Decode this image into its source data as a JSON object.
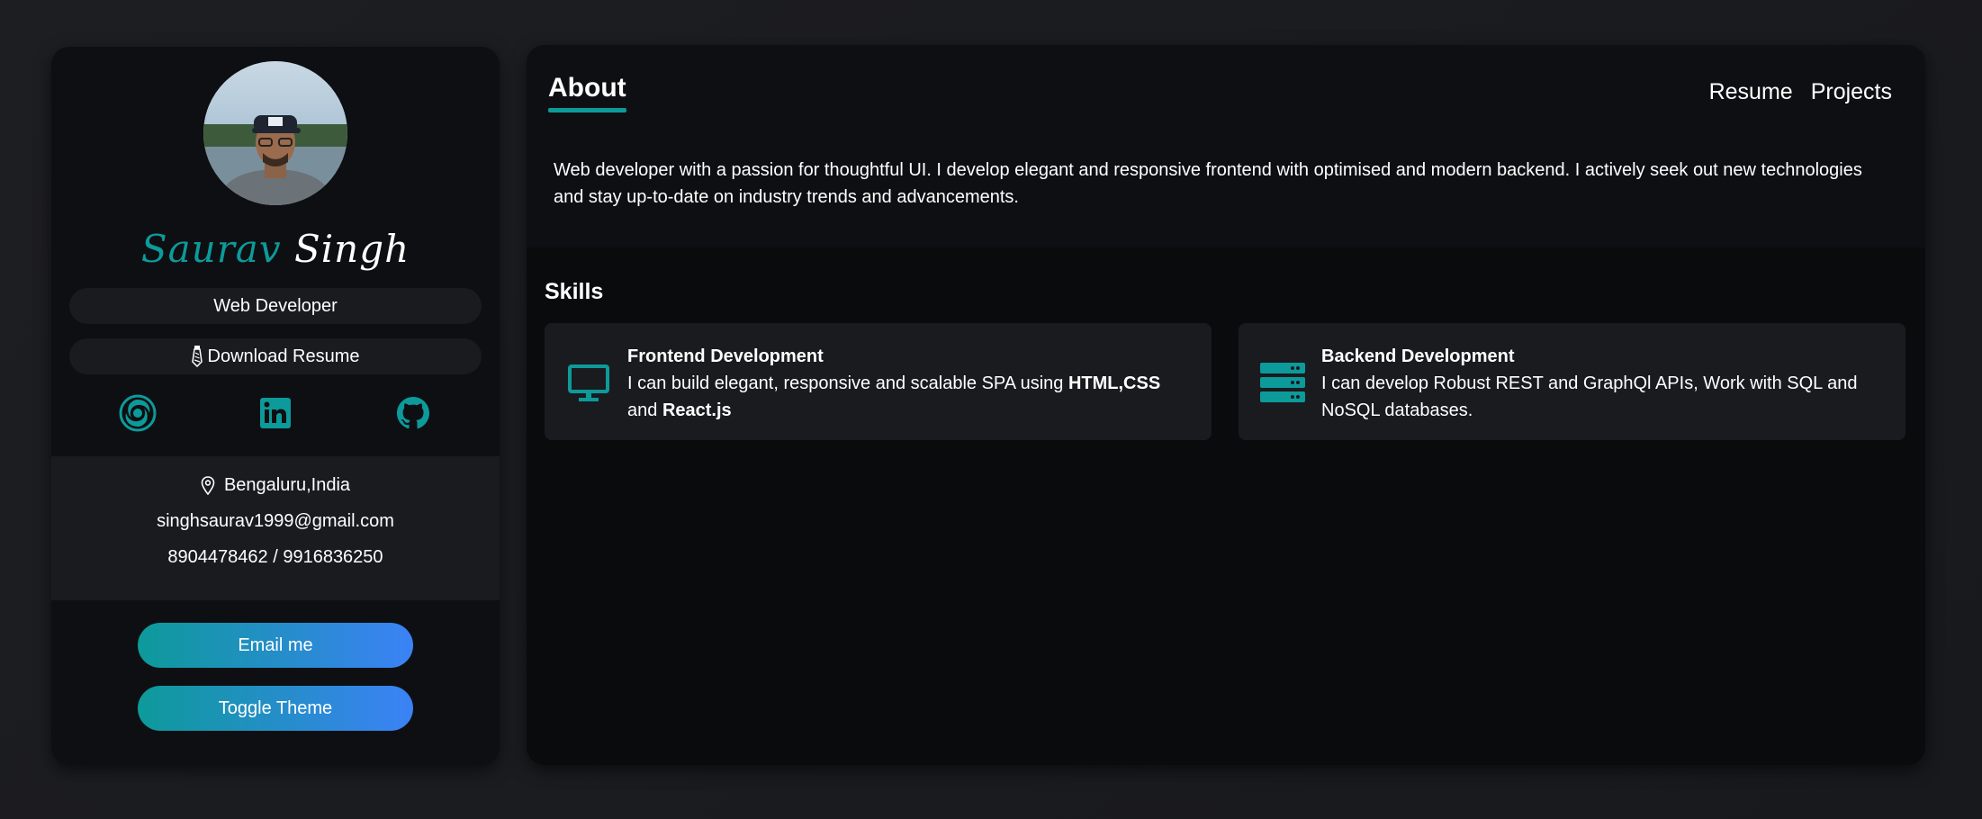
{
  "profile": {
    "first_name": "Saurav",
    "last_name": "Singh",
    "role": "Web Developer",
    "download_label": "Download Resume",
    "location": "Bengaluru,India",
    "email": "singhsaurav1999@gmail.com",
    "phone": "8904478462 / 9916836250"
  },
  "socials": [
    {
      "icon": "swirl-logo-icon"
    },
    {
      "icon": "linkedin-icon"
    },
    {
      "icon": "github-icon"
    }
  ],
  "buttons": {
    "email": "Email me",
    "theme": "Toggle Theme"
  },
  "header": {
    "title": "About",
    "nav": [
      "Resume",
      "Projects"
    ]
  },
  "about": {
    "text": "Web developer with a passion for thoughtful UI. I develop elegant and responsive frontend with optimised and modern backend. I actively seek out new technologies and stay up-to-date on industry trends and advancements."
  },
  "skills": {
    "title": "Skills",
    "items": [
      {
        "title": "Frontend Development",
        "text_pre": "I can build elegant, responsive and scalable SPA using ",
        "bold1": "HTML,CSS",
        "text_mid": " and ",
        "bold2": "React.js",
        "icon": "monitor-icon"
      },
      {
        "title": "Backend Development",
        "text": "I can develop Robust REST and GraphQl APIs, Work with SQL and NoSQL databases.",
        "icon": "server-icon"
      }
    ]
  },
  "colors": {
    "accent": "#0d9a9a",
    "gradient_end": "#3b82f6",
    "background": "#1b1c20",
    "panel": "#0e0f12",
    "card": "#1a1b1f"
  }
}
